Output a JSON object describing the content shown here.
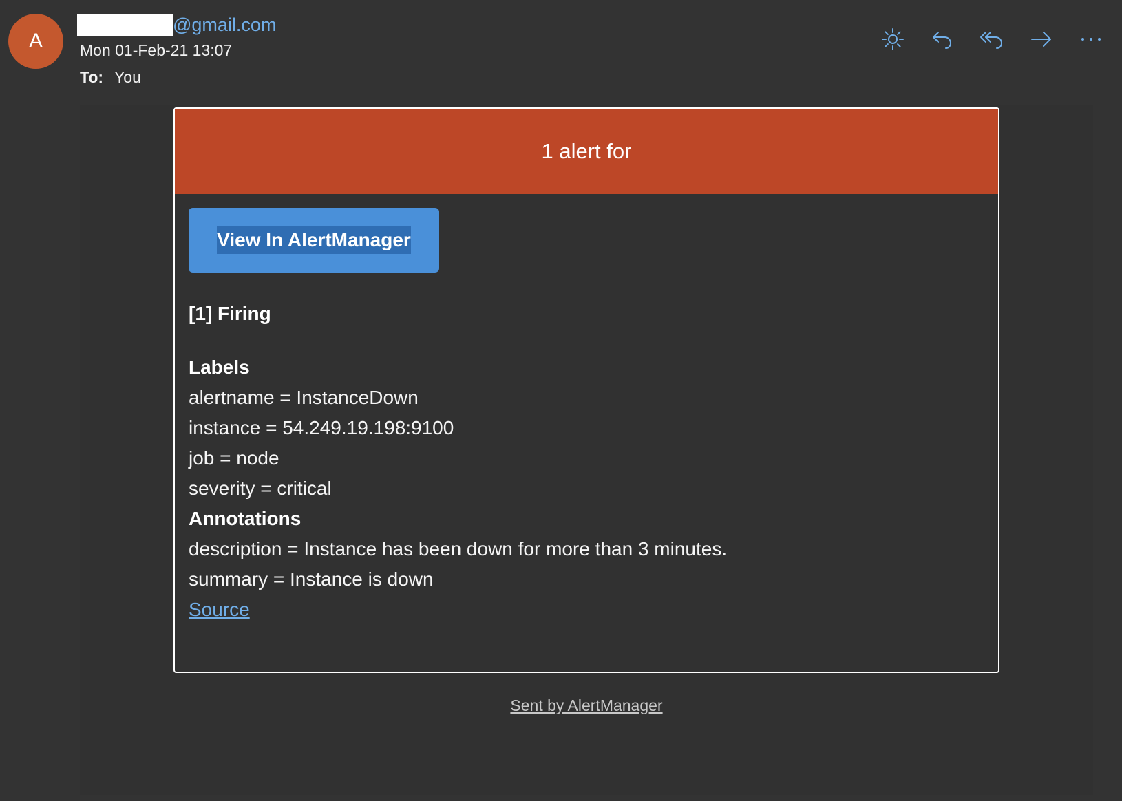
{
  "header": {
    "avatar_initial": "A",
    "sender_domain": "@gmail.com",
    "date": "Mon 01-Feb-21 13:07",
    "to_label": "To:",
    "to_value": "You"
  },
  "toolbar": {
    "icons": [
      "sun-icon",
      "reply-icon",
      "reply-all-icon",
      "forward-icon",
      "more-icon"
    ]
  },
  "alert": {
    "header_title": "1 alert for",
    "view_button_label": "View In AlertManager",
    "firing_label": "[1] Firing",
    "labels_title": "Labels",
    "labels": [
      "alertname = InstanceDown",
      "instance = 54.249.19.198:9100",
      "job = node",
      "severity = critical"
    ],
    "annotations_title": "Annotations",
    "annotations": [
      "description = Instance has been down for more than 3 minutes.",
      "summary = Instance is down"
    ],
    "source_link": "Source"
  },
  "footer": {
    "sent_by": "Sent by AlertManager"
  },
  "colors": {
    "background": "#333333",
    "accent_link": "#70aee8",
    "alert_header": "#bd4727",
    "button": "#4a90d9",
    "avatar": "#c4582e"
  }
}
